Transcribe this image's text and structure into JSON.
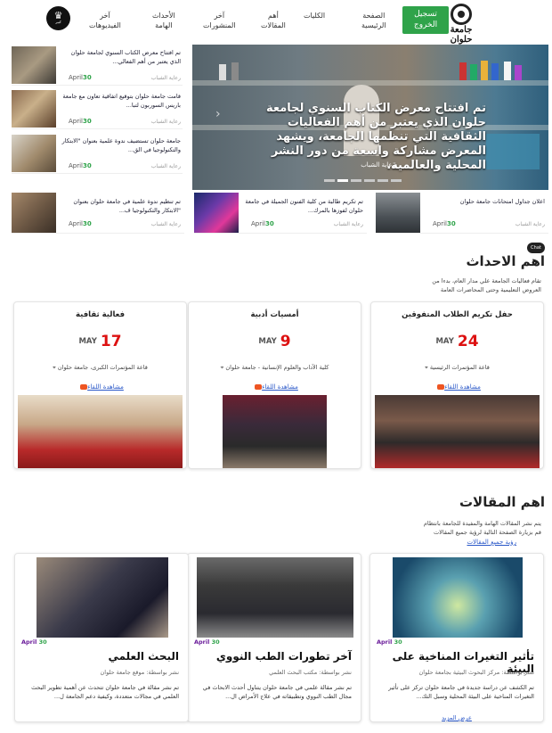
{
  "header": {
    "logo_text": "جامعة حلوان",
    "logout": "تسجيل\nالخروج",
    "nav": [
      "الصفحة\nالرئيسية",
      "الكليات",
      "أهم\nالمقالات",
      "آخر\nالمنشورات",
      "الأحداث\nالهامة",
      "آخر\nالفيديوهات"
    ],
    "crown_label": "كبير"
  },
  "hero": {
    "title": "تم افتتاح معرض الكتاب السنوي لجامعة حلوان الذي يعتبر من أهم الفعاليات الثقافية التي تنظمها الجامعة، ويشهد المعرض مشاركة واسعة من دور النشر المحلية والعالمية.",
    "source": "رعاية الشباب",
    "prev": "‹",
    "next": "›"
  },
  "side_news": [
    {
      "title": "تم افتتاح معرض الكتاب السنوي لجامعة حلوان الذي يعتبر من أهم الفعالي...",
      "day": "30",
      "month": "April",
      "source": "رعاية الشباب"
    },
    {
      "title": "قامت جامعة حلوان بتوقيع اتفاقية تعاون مع جامعة باريس السوربون لتبا...",
      "day": "30",
      "month": "April",
      "source": "رعاية الشباب"
    },
    {
      "title": "جامعة حلوان تستضيف ندوة علمية بعنوان \"الابتكار والتكنولوجيا في الق...",
      "day": "30",
      "month": "April",
      "source": "رعاية الشباب"
    }
  ],
  "bottom_news": [
    {
      "title": "اعلان جداول امتحانات جامعة حلوان",
      "day": "30",
      "month": "April",
      "source": "رعاية الشباب"
    },
    {
      "title": "تم تكريم طالبة من كلية الفنون الجميلة في جامعة حلوان لفوزها بالمرك...",
      "day": "30",
      "month": "April",
      "source": "رعاية الشباب"
    },
    {
      "title": "تم تنظيم ندوة علمية في جامعة حلوان بعنوان \"الابتكار والتكنولوجيا ف...",
      "day": "30",
      "month": "April",
      "source": "رعاية الشباب"
    }
  ],
  "chat_bubble": "Chat",
  "events": {
    "title": "اهم الاحداث",
    "desc": "تقام فعاليات الجامعة علي مدار العام، بدءا من\nالعروض التعليمية وحتى المحاضرات العامة",
    "items": [
      {
        "title": "حفل تكريم الطلاب المتفوقين",
        "month": "MAY",
        "day": "24",
        "location": "قاعة المؤتمرات الرئيسية",
        "watch": "مشاهدة اللقاء"
      },
      {
        "title": "أمسيات أدبية",
        "month": "MAY",
        "day": "9",
        "location": "كلية الآداب والعلوم الإنسانية - جامعة حلوان",
        "watch": "مشاهدة اللقاء"
      },
      {
        "title": "فعالية ثقافية",
        "month": "MAY",
        "day": "17",
        "location": "قاعة المؤتمرات الكبرى، جامعة حلوان",
        "watch": "مشاهدة اللقاء"
      }
    ]
  },
  "articles": {
    "title": "اهم المقالات",
    "desc": "يتم نشر المقالات الهامة والمفيدة للجامعة بانتظام\nقم بزيارة الصفحة التالية لرؤية جميع المقالات",
    "link": "رؤية جميع المقالات",
    "items": [
      {
        "title": "تأثير التغيرات المناخية على البيئة",
        "by": "نشر بواسطة: مركز البحوث البيئية بجامعة حلوان",
        "body": "تم الكشف عن دراسة جديدة في جامعة حلوان تركز على تأثير التغيرات المناخية على البيئة المحلية وسبل التك...",
        "day": "30",
        "month": "April",
        "more": "عرض المزيد"
      },
      {
        "title": "آخر تطورات الطب النووي",
        "by": "نشر بواسطة: مكتب البحث العلمي",
        "body": "تم نشر مقالة علمي في جامعة حلوان يتناول أحدث الابحاث في مجال الطب النووي وتطبيقاته في علاج الأمراض ال...",
        "day": "30",
        "month": "April",
        "more": ""
      },
      {
        "title": "البحث العلمي",
        "by": "نشر بواسطة: موقع جامعة حلوان",
        "body": "تم نشر مقالة في جامعة حلوان تتحدث عن أهمية تطوير البحث العلمي في مجالات متعددة، وكيفية دعم الجامعة ل...",
        "day": "30",
        "month": "April",
        "more": ""
      }
    ]
  }
}
